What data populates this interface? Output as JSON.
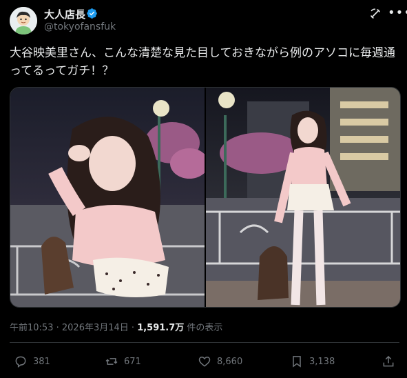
{
  "author": {
    "name": "大人店長",
    "handle": "@tokyofansfuk"
  },
  "tweet": {
    "text": "大谷映美里さん、こんな清楚な見た目しておきながら例のアソコに毎週通ってるってガチ！？"
  },
  "meta": {
    "time": "午前10:53",
    "separator1": " · ",
    "date": "2026年3月14日",
    "separator2": " · ",
    "views": "1,591.7万",
    "views_label": " 件の表示"
  },
  "actions": {
    "reply_count": "381",
    "retweet_count": "671",
    "like_count": "8,660",
    "bookmark_count": "3,138"
  },
  "colors": {
    "background": "#000000",
    "text": "#e7e9ea",
    "muted": "#71767b",
    "verified": "#1d9bf0",
    "divider": "#2f3336"
  }
}
